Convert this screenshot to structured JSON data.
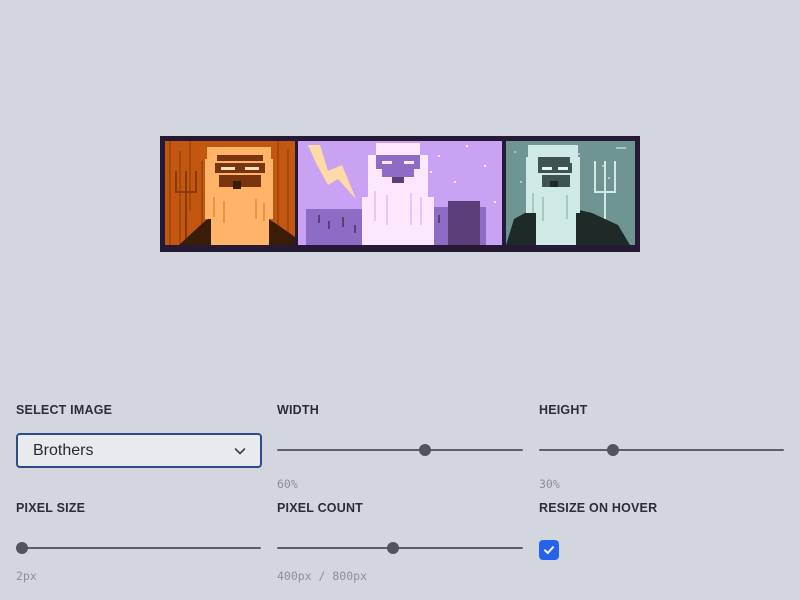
{
  "image_strip": {
    "panels": [
      {
        "icon": "poseidon-orange-pixel-portrait",
        "colors": {
          "bg": "#c2570f",
          "fg": "#ffb46a",
          "dark": "#3a1c08"
        }
      },
      {
        "icon": "zeus-purple-pixel-portrait",
        "colors": {
          "bg": "#c9a2f4",
          "fg": "#fbe8ff",
          "dark": "#5a3f7a"
        }
      },
      {
        "icon": "hades-teal-pixel-portrait",
        "colors": {
          "bg": "#6f9592",
          "fg": "#cfe9e4",
          "dark": "#1d2a28"
        }
      }
    ]
  },
  "controls": {
    "select_image": {
      "label": "SELECT IMAGE",
      "value": "Brothers",
      "icon": "chevron-down-icon"
    },
    "width": {
      "label": "WIDTH",
      "value_text": "60%",
      "fraction": 0.6
    },
    "height": {
      "label": "HEIGHT",
      "value_text": "30%",
      "fraction": 0.3
    },
    "pixel_size": {
      "label": "PIXEL SIZE",
      "value_text": "2px",
      "fraction": 0.0
    },
    "pixel_count": {
      "label": "PIXEL COUNT",
      "value_text": "400px / 800px",
      "fraction": 0.47
    },
    "resize_on_hover": {
      "label": "RESIZE ON HOVER",
      "checked": true,
      "icon": "checkmark-icon",
      "accent": "#2563eb"
    }
  }
}
